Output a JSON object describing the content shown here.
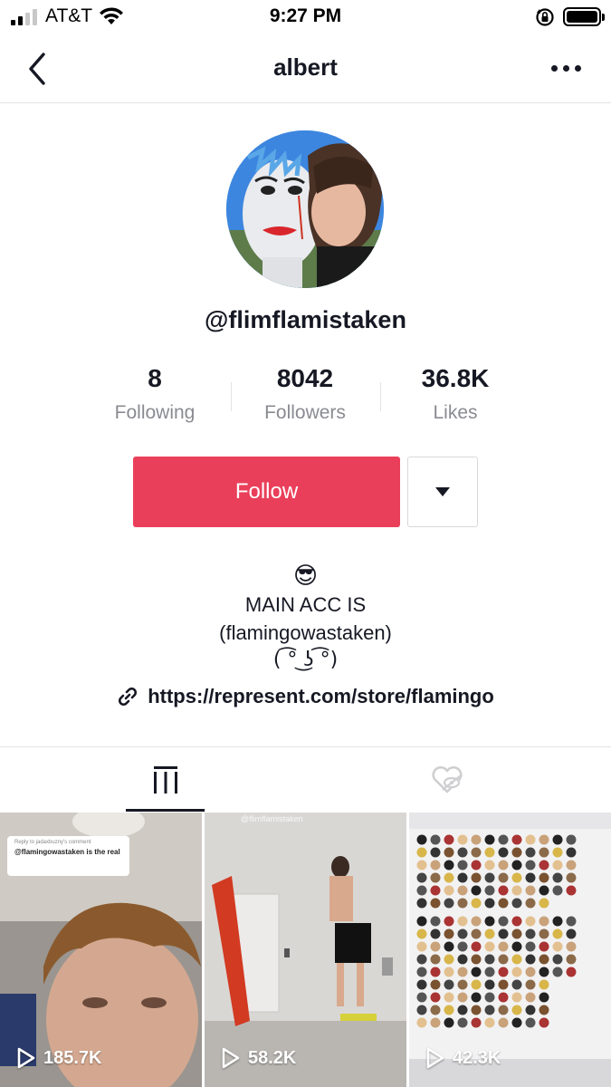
{
  "status_bar": {
    "carrier": "AT&T",
    "time": "9:27 PM"
  },
  "nav": {
    "title": "albert"
  },
  "profile": {
    "username": "@flimflamistaken",
    "stats": [
      {
        "value": "8",
        "label": "Following"
      },
      {
        "value": "8042",
        "label": "Followers"
      },
      {
        "value": "36.8K",
        "label": "Likes"
      }
    ],
    "follow_label": "Follow",
    "bio": {
      "emoji": "😎",
      "line1": "MAIN ACC IS",
      "line2": "(flamingowastaken)",
      "face": "( ͡° ͜ʖ ͡°)"
    },
    "link": "https://represent.com/store/flamingo"
  },
  "videos": [
    {
      "views": "185.7K",
      "reply_header": "Reply to jadaxbuzny's comment",
      "reply_text": "@flamingowastaken is the real"
    },
    {
      "views": "58.2K",
      "watermark": "@flimflamistaken"
    },
    {
      "views": "42.3K"
    }
  ],
  "colors": {
    "follow": "#ea3f5a",
    "text": "#161823",
    "secondary": "#8a8b91"
  }
}
